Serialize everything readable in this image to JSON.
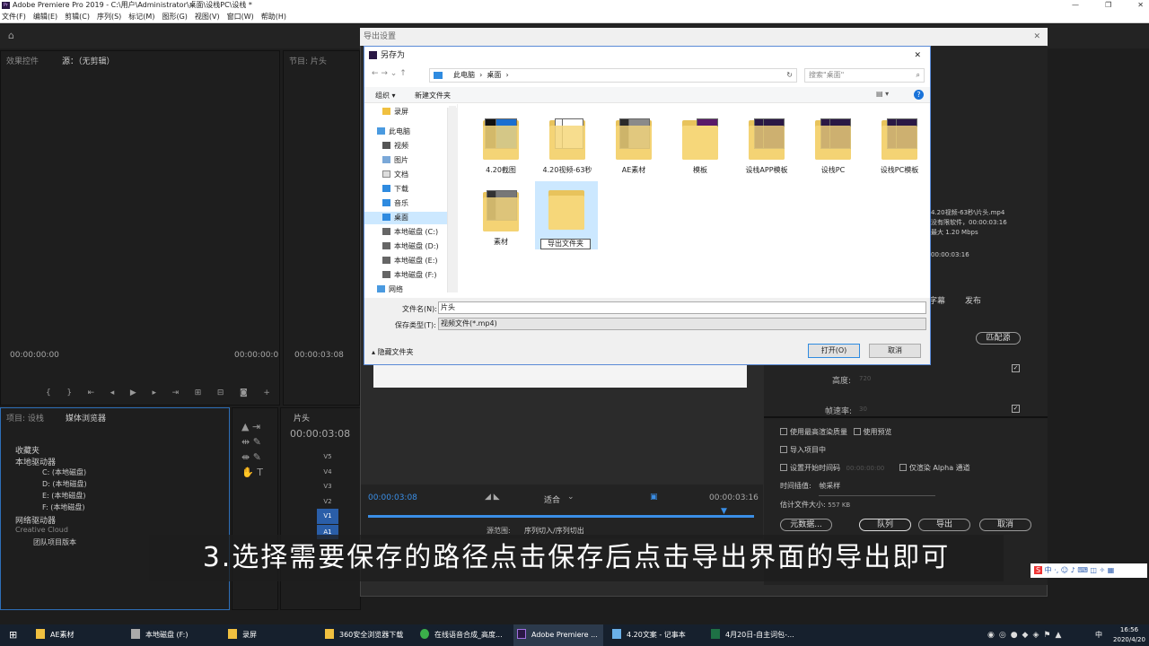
{
  "titlebar": {
    "title": "Adobe Premiere Pro 2019 - C:\\用户\\Administrator\\桌面\\设栈PC\\设栈 *",
    "logo": "Pr"
  },
  "menu": [
    "文件(F)",
    "编辑(E)",
    "剪辑(C)",
    "序列(S)",
    "标记(M)",
    "图形(G)",
    "视图(V)",
    "窗口(W)",
    "帮助(H)"
  ],
  "source_panel": {
    "tab1": "效果控件",
    "tab2": "源：（无剪辑）",
    "timecode": "00:00:00:00",
    "timecode2": "00:00:00:0"
  },
  "program_panel": {
    "tab": "节目: 片头",
    "timecode": "00:00:03:08"
  },
  "project_panel": {
    "tab1": "项目: 设栈",
    "tab2": "媒体浏览器",
    "items": [
      "收藏夹",
      "本地驱动器",
      "C: (本地磁盘)",
      "D: (本地磁盘)",
      "E: (本地磁盘)",
      "F: (本地磁盘)",
      "网络驱动器",
      "Creative Cloud",
      "团队项目版本"
    ]
  },
  "timeline": {
    "tab": "片头",
    "timecode": "00:00:03:08",
    "tracks": [
      "V5",
      "V4",
      "V3",
      "V2",
      "V1",
      "A1"
    ]
  },
  "export_dialog": {
    "title": "导出设置",
    "bottom_timecode_left": "00:00:03:08",
    "bottom_timecode_right": "00:00:03:16",
    "fit": "适合",
    "range_label": "源范围:",
    "range_value": "序列切入/序列切出",
    "summary_lines": [
      "4.20视频-63秒\\片头.mp4",
      "没有限软件，00:00:03:16",
      "最大 1.20 Mbps",
      "00:00:03:16"
    ],
    "tabs": [
      "字幕",
      "发布"
    ],
    "match_source": "匹配源",
    "height_label": "高度:",
    "height_value": "720",
    "framerate_label": "帧速率:",
    "framerate_value": "30",
    "opt_max_quality": "使用最高渲染质量",
    "opt_preview": "使用预览",
    "opt_import": "导入项目中",
    "opt_start_tc": "设置开始时间码",
    "opt_start_tc_value": "00:00:00:00",
    "opt_alpha": "仅渲染 Alpha 通道",
    "interp_label": "时间插值:",
    "interp_value": "帧采样",
    "filesize_label": "估计文件大小:",
    "filesize_value": "557 KB",
    "buttons": [
      "元数据...",
      "队列",
      "导出",
      "取消"
    ]
  },
  "save_as": {
    "title": "另存为",
    "breadcrumb": [
      "此电脑",
      "桌面"
    ],
    "search_placeholder": "搜索\"桌面\"",
    "organize": "组织 ▾",
    "new_folder": "新建文件夹",
    "nav": [
      "录屏",
      "此电脑",
      "视频",
      "图片",
      "文档",
      "下载",
      "音乐",
      "桌面",
      "本地磁盘 (C:)",
      "本地磁盘 (D:)",
      "本地磁盘 (E:)",
      "本地磁盘 (F:)",
      "网络"
    ],
    "folders": [
      "4.20截图",
      "4.20视频-63秒",
      "AE素材",
      "模板",
      "设栈APP模板",
      "设栈PC",
      "设栈PC模板",
      "素材"
    ],
    "new_folder_edit": "导出文件夹",
    "filename_label": "文件名(N):",
    "filename_value": "片头",
    "filetype_label": "保存类型(T):",
    "filetype_value": "视频文件(*.mp4)",
    "hide_folders": "隐藏文件夹",
    "open": "打开(O)",
    "cancel": "取消"
  },
  "caption": "3.选择需要保存的路径点击保存后点击导出界面的导出即可",
  "tray": {
    "ime": "中",
    "time": "16:56",
    "date": "2020/4/20"
  },
  "taskbar": [
    "AE素材",
    "本地磁盘 (F:)",
    "录屏",
    "360安全浏览器下载",
    "在线语音合成_高度...",
    "Adobe Premiere ...",
    "4.20文案 - 记事本",
    "4月20日-自主词包-..."
  ]
}
